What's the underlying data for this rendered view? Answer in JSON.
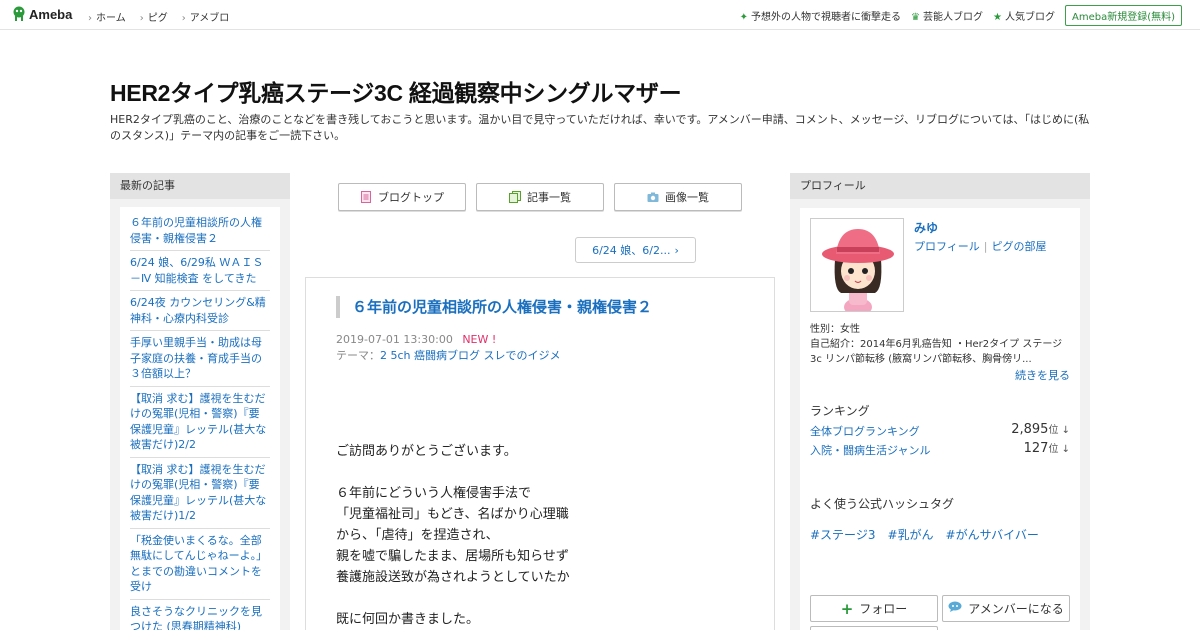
{
  "topbar": {
    "logo_text": "Ameba",
    "nav": [
      "ホーム",
      "ピグ",
      "アメブロ"
    ],
    "right_links": [
      "予想外の人物で視聴者に衝撃走る",
      "芸能人ブログ",
      "人気ブログ"
    ],
    "signup_label": "Ameba新規登録(無料)"
  },
  "header": {
    "title": "HER2タイプ乳癌ステージ3C 経過観察中シングルマザー",
    "description": "HER2タイプ乳癌のこと、治療のことなどを書き残しておこうと思います。温かい目で見守っていただければ、幸いです。アメンバー申請、コメント、メッセージ、リブログについては、「はじめに(私のスタンス)」テーマ内の記事をご一読下さい。"
  },
  "left": {
    "heading": "最新の記事",
    "items": [
      "６年前の児童相談所の人権侵害・親権侵害２",
      "6/24 娘、6/29私 ＷＡＩＳ－Ⅳ 知能検査 をしてきた",
      "6/24夜 カウンセリング&精神科・心療内科受診",
      "手厚い里親手当・助成は母子家庭の扶養・育成手当の３倍額以上？",
      "【取消 求む】護視を生むだけの冤罪(児相・警察)『要保護児童』レッテル(甚大な被害だけ)2/2",
      "【取消 求む】護視を生むだけの冤罪(児相・警察)『要保護児童』レッテル(甚大な被害だけ)1/2",
      "「税金使いまくるな。全部無駄にしてんじゃねーよ。」とまでの勘違いコメントを受け",
      "良さそうなクリニックを見つけた (思春期精神科)"
    ]
  },
  "center": {
    "buttons": [
      "ブログトップ",
      "記事一覧",
      "画像一覧"
    ],
    "next_label": "6/24 娘、6/2...",
    "article": {
      "title": "６年前の児童相談所の人権侵害・親権侵害２",
      "datetime": "2019-07-01 13:30:00",
      "new_badge": "NEW !",
      "theme_label": "テーマ：",
      "theme": "2 5ch 癌闘病ブログ スレでのイジメ",
      "body": [
        "ご訪問ありがとうございます。",
        "",
        "６年前にどういう人権侵害手法で",
        "「児童福祉司」もどき、名ばかり心理職",
        "から、「虐待」を捏造され、",
        "親を嘘で騙したまま、居場所も知らせず",
        "養護施設送致が為されようとしていたか",
        "",
        "既に何回か書きました。"
      ]
    }
  },
  "right": {
    "heading": "プロフィール",
    "name": "みゆ",
    "link_profile": "プロフィール",
    "link_pigg": "ピグの部屋",
    "gender": "性別：女性",
    "intro": "自己紹介：2014年6月乳癌告知 ・Her2タイプ ステージ3c リンパ節転移 (腋窩リンパ節転移、胸骨傍リ...",
    "more": "続きを見る",
    "ranking_heading": "ランキング",
    "rankings": [
      {
        "label": "全体ブログランキング",
        "value": "2,895",
        "unit": "位 ↓"
      },
      {
        "label": "入院・闘病生活ジャンル",
        "value": "127",
        "unit": "位 ↓"
      }
    ],
    "hashtag_heading": "よく使う公式ハッシュタグ",
    "hashtags": [
      "#ステージ3",
      "#乳がん",
      "#がんサバイバー"
    ],
    "follow_label": "フォロー",
    "amember_label": "アメンバーになる"
  },
  "colors": {
    "link": "#1a6fbf",
    "new_badge": "#e0306a",
    "ameba_green": "#2a9a3a",
    "sidebar_head": "#e3e3e3"
  }
}
